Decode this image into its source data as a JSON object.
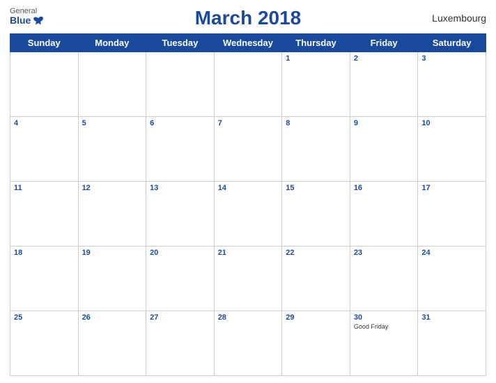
{
  "header": {
    "title": "March 2018",
    "country": "Luxembourg",
    "logo_general": "General",
    "logo_blue": "Blue"
  },
  "weekdays": [
    "Sunday",
    "Monday",
    "Tuesday",
    "Wednesday",
    "Thursday",
    "Friday",
    "Saturday"
  ],
  "weeks": [
    [
      {
        "day": "",
        "empty": true
      },
      {
        "day": "",
        "empty": true
      },
      {
        "day": "",
        "empty": true
      },
      {
        "day": "",
        "empty": true
      },
      {
        "day": "1",
        "empty": false,
        "event": ""
      },
      {
        "day": "2",
        "empty": false,
        "event": ""
      },
      {
        "day": "3",
        "empty": false,
        "event": ""
      }
    ],
    [
      {
        "day": "4",
        "empty": false,
        "event": ""
      },
      {
        "day": "5",
        "empty": false,
        "event": ""
      },
      {
        "day": "6",
        "empty": false,
        "event": ""
      },
      {
        "day": "7",
        "empty": false,
        "event": ""
      },
      {
        "day": "8",
        "empty": false,
        "event": ""
      },
      {
        "day": "9",
        "empty": false,
        "event": ""
      },
      {
        "day": "10",
        "empty": false,
        "event": ""
      }
    ],
    [
      {
        "day": "11",
        "empty": false,
        "event": ""
      },
      {
        "day": "12",
        "empty": false,
        "event": ""
      },
      {
        "day": "13",
        "empty": false,
        "event": ""
      },
      {
        "day": "14",
        "empty": false,
        "event": ""
      },
      {
        "day": "15",
        "empty": false,
        "event": ""
      },
      {
        "day": "16",
        "empty": false,
        "event": ""
      },
      {
        "day": "17",
        "empty": false,
        "event": ""
      }
    ],
    [
      {
        "day": "18",
        "empty": false,
        "event": ""
      },
      {
        "day": "19",
        "empty": false,
        "event": ""
      },
      {
        "day": "20",
        "empty": false,
        "event": ""
      },
      {
        "day": "21",
        "empty": false,
        "event": ""
      },
      {
        "day": "22",
        "empty": false,
        "event": ""
      },
      {
        "day": "23",
        "empty": false,
        "event": ""
      },
      {
        "day": "24",
        "empty": false,
        "event": ""
      }
    ],
    [
      {
        "day": "25",
        "empty": false,
        "event": ""
      },
      {
        "day": "26",
        "empty": false,
        "event": ""
      },
      {
        "day": "27",
        "empty": false,
        "event": ""
      },
      {
        "day": "28",
        "empty": false,
        "event": ""
      },
      {
        "day": "29",
        "empty": false,
        "event": ""
      },
      {
        "day": "30",
        "empty": false,
        "event": "Good Friday"
      },
      {
        "day": "31",
        "empty": false,
        "event": ""
      }
    ]
  ],
  "colors": {
    "header_bg": "#1a4a9e",
    "header_text": "#ffffff",
    "day_number": "#1a4a9e",
    "border": "#cccccc"
  }
}
